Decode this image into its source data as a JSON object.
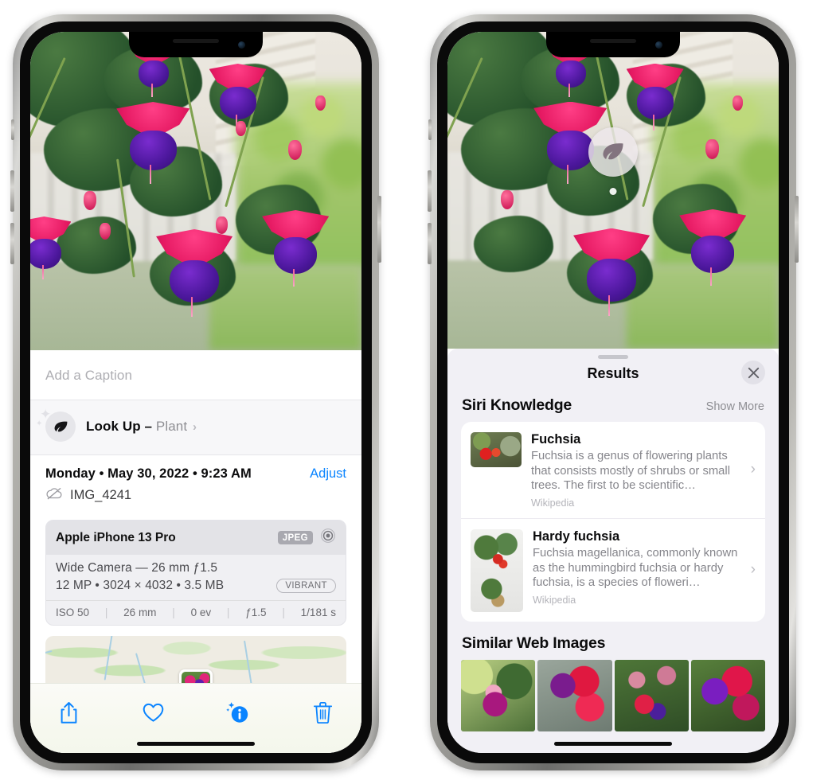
{
  "left_phone": {
    "caption_placeholder": "Add a Caption",
    "lookup": {
      "label": "Look Up –",
      "subject": "Plant",
      "chevron": "›",
      "icon": "leaf-icon"
    },
    "meta": {
      "date": "Monday • May 30, 2022 • 9:23 AM",
      "adjust_label": "Adjust",
      "filename": "IMG_4241",
      "cloud_icon": "icloud-slash-icon"
    },
    "camera_card": {
      "device": "Apple iPhone 13 Pro",
      "format_badge": "JPEG",
      "aperture_icon": "camera-aperture-icon",
      "lens_line": "Wide Camera — 26 mm ƒ1.5",
      "specs_line": "12 MP • 3024 × 4032 • 3.5 MB",
      "style_badge": "VIBRANT",
      "exif": [
        "ISO 50",
        "26 mm",
        "0 ev",
        "ƒ1.5",
        "1/181 s"
      ]
    },
    "toolbar": [
      {
        "name": "share-button",
        "icon": "share-icon"
      },
      {
        "name": "favorite-button",
        "icon": "heart-icon"
      },
      {
        "name": "info-button",
        "icon": "info-sparkle-icon"
      },
      {
        "name": "delete-button",
        "icon": "trash-icon"
      }
    ],
    "accent_color": "#0a84ff"
  },
  "right_phone": {
    "visual_lookup_badge": {
      "icon": "leaf-icon"
    },
    "sheet": {
      "title": "Results",
      "close_icon": "close-icon",
      "siri_knowledge": {
        "heading": "Siri Knowledge",
        "show_more": "Show More",
        "items": [
          {
            "title": "Fuchsia",
            "description": "Fuchsia is a genus of flowering plants that consists mostly of shrubs or small trees. The first to be scientific…",
            "source": "Wikipedia",
            "chevron": "›"
          },
          {
            "title": "Hardy fuchsia",
            "description": "Fuchsia magellanica, commonly known as the hummingbird fuchsia or hardy fuchsia, is a species of floweri…",
            "source": "Wikipedia",
            "chevron": "›"
          }
        ]
      },
      "similar_web_images": {
        "heading": "Similar Web Images",
        "thumbnails": [
          "fuchsia-thumb-1",
          "fuchsia-thumb-2",
          "fuchsia-thumb-3",
          "fuchsia-thumb-4"
        ]
      }
    }
  }
}
